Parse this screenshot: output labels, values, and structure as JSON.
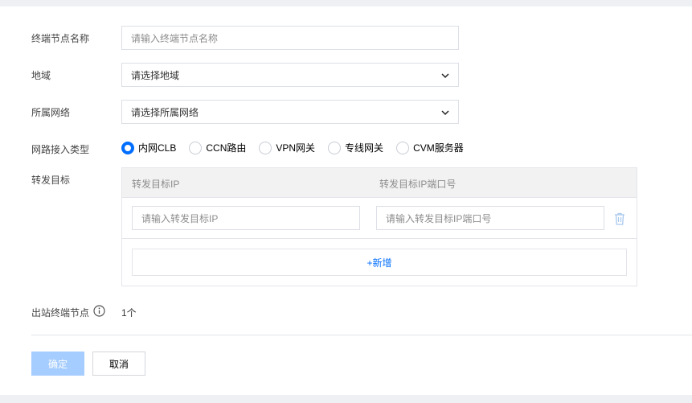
{
  "form": {
    "name_label": "终端节点名称",
    "name_placeholder": "请输入终端节点名称",
    "region_label": "地域",
    "region_value": "请选择地域",
    "network_label": "所属网络",
    "network_value": "请选择所属网络",
    "access_type_label": "网路接入类型",
    "access_types": [
      {
        "label": "内网CLB",
        "checked": true
      },
      {
        "label": "CCN路由",
        "checked": false
      },
      {
        "label": "VPN网关",
        "checked": false
      },
      {
        "label": "专线网关",
        "checked": false
      },
      {
        "label": "CVM服务器",
        "checked": false
      }
    ],
    "forward_label": "转发目标",
    "forward_table": {
      "col_ip": "转发目标IP",
      "col_port": "转发目标IP端口号",
      "ip_placeholder": "请输入转发目标IP",
      "port_placeholder": "请输入转发目标IP端口号",
      "add_label": "+新增"
    },
    "outbound_label": "出站终端节点",
    "outbound_value": "1个"
  },
  "footer": {
    "confirm_label": "确定",
    "cancel_label": "取消"
  },
  "colors": {
    "accent": "#006eff",
    "accent_disabled": "#a6cdff",
    "border": "#dcdfe6"
  }
}
